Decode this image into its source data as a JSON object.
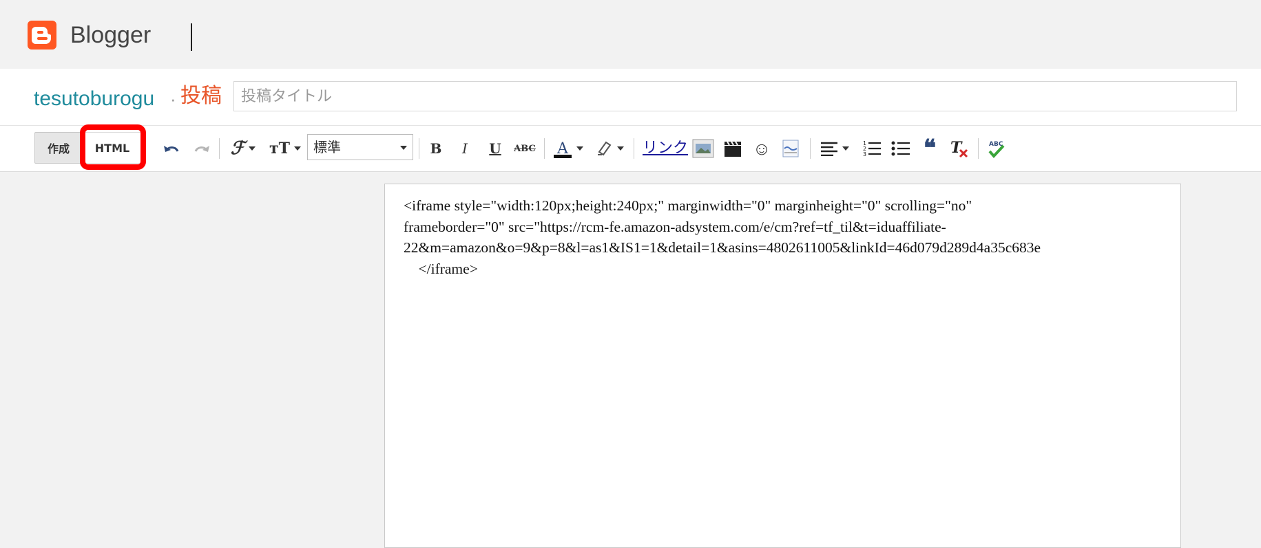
{
  "app": {
    "name": "Blogger",
    "colors": {
      "brand": "#ff5722",
      "blog_name": "#1f8b9c",
      "post_label": "#e8562a",
      "highlight": "#ff0000"
    }
  },
  "header": {
    "blog_name": "tesutoburogu",
    "separator": "·",
    "post_label": "投稿",
    "title_placeholder": "投稿タイトル"
  },
  "toolbar": {
    "compose_label": "作成",
    "html_label": "HTML",
    "style_select_value": "標準",
    "link_label": "リンク",
    "icons": [
      "undo-icon",
      "redo-icon",
      "font-family-icon",
      "font-size-icon",
      "bold-icon",
      "italic-icon",
      "underline-icon",
      "strikethrough-icon",
      "text-color-icon",
      "highlight-color-icon",
      "image-icon",
      "video-icon",
      "emoji-icon",
      "jump-break-icon",
      "align-icon",
      "numbered-list-icon",
      "bullet-list-icon",
      "quote-icon",
      "clear-format-icon",
      "spellcheck-icon"
    ]
  },
  "editor": {
    "lines": [
      "<iframe style=\"width:120px;height:240px;\" marginwidth=\"0\" marginheight=\"0\" scrolling=\"no\"",
      "frameborder=\"0\" src=\"https://rcm-fe.amazon-adsystem.com/e/cm?ref=tf_til&t=iduaffiliate-",
      "22&m=amazon&o=9&p=8&l=as1&IS1=1&detail=1&asins=4802611005&linkId=46d079d289d4a35c683e",
      "    </iframe>"
    ]
  }
}
